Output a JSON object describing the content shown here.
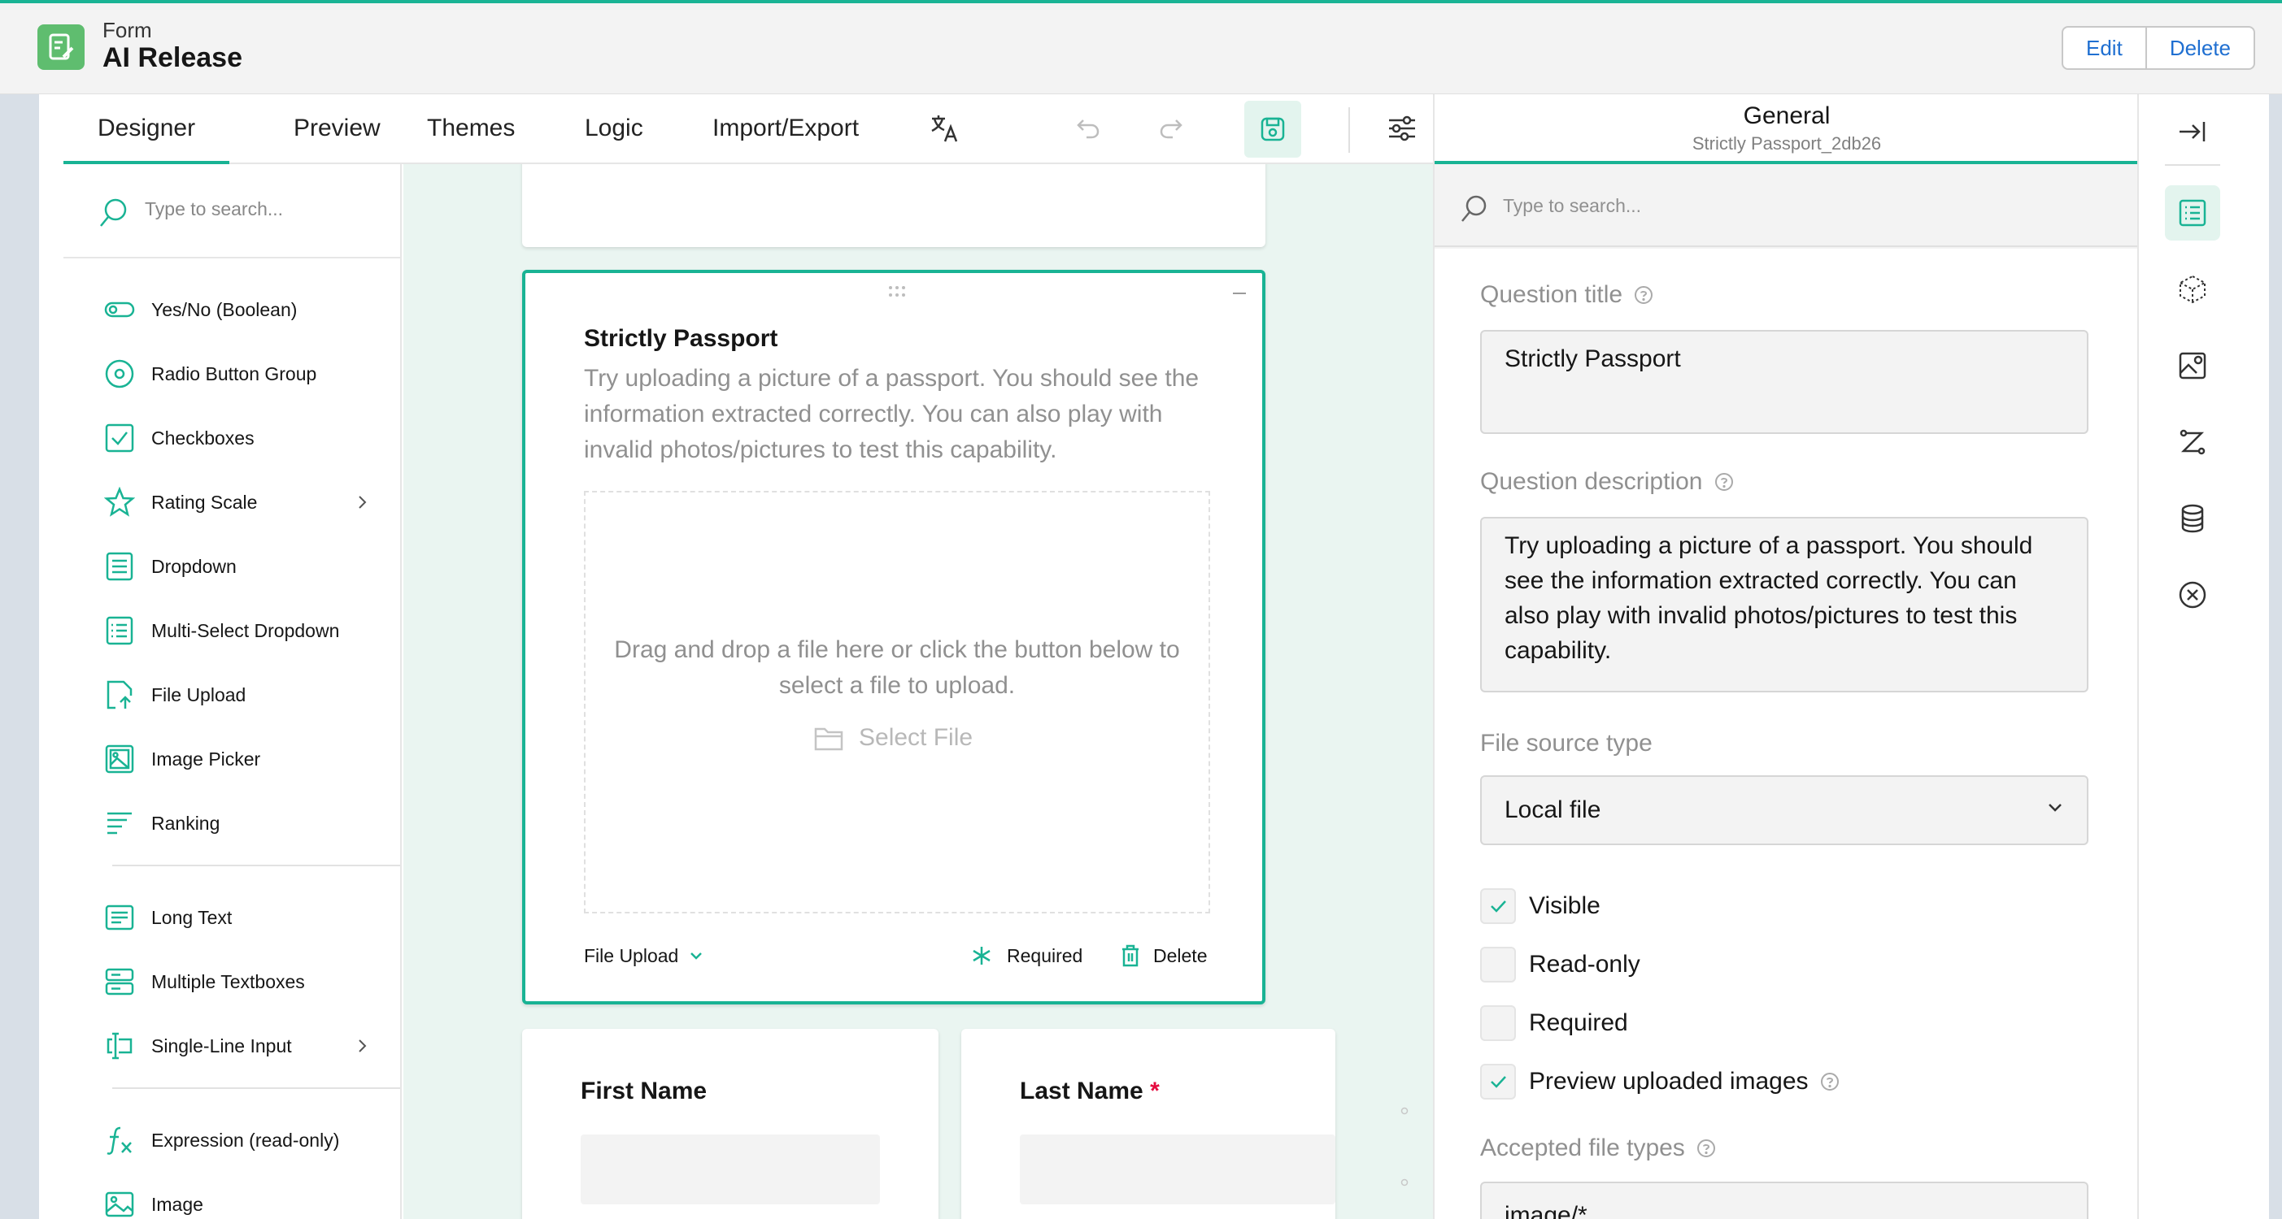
{
  "header": {
    "app_kind": "Form",
    "app_title": "AI Release",
    "edit_label": "Edit",
    "delete_label": "Delete"
  },
  "tabs": [
    {
      "label": "Designer",
      "active": true
    },
    {
      "label": "Preview"
    },
    {
      "label": "Themes"
    },
    {
      "label": "Logic"
    },
    {
      "label": "Import/Export"
    }
  ],
  "toolbox": {
    "search_placeholder": "Type to search...",
    "items": [
      {
        "label": "Yes/No (Boolean)",
        "icon": "toggle-icon"
      },
      {
        "label": "Radio Button Group",
        "icon": "radio-icon"
      },
      {
        "label": "Checkboxes",
        "icon": "checkbox-icon"
      },
      {
        "label": "Rating Scale",
        "icon": "star-icon",
        "has_submenu": true
      },
      {
        "label": "Dropdown",
        "icon": "dropdown-icon"
      },
      {
        "label": "Multi-Select Dropdown",
        "icon": "multi-dropdown-icon"
      },
      {
        "label": "File Upload",
        "icon": "file-upload-icon"
      },
      {
        "label": "Image Picker",
        "icon": "image-picker-icon"
      },
      {
        "label": "Ranking",
        "icon": "ranking-icon"
      },
      {
        "label": "Long Text",
        "icon": "long-text-icon"
      },
      {
        "label": "Multiple Textboxes",
        "icon": "multiple-textboxes-icon"
      },
      {
        "label": "Single-Line Input",
        "icon": "single-line-input-icon",
        "has_submenu": true
      },
      {
        "label": "Expression (read-only)",
        "icon": "expression-icon"
      },
      {
        "label": "Image",
        "icon": "image-icon"
      }
    ]
  },
  "question": {
    "title": "Strictly Passport",
    "description": "Try uploading a picture of a passport. You should see the information extracted correctly. You can also play with invalid photos/pictures to test this capability.",
    "dropzone_text": "Drag and drop a file here or click the button below to select a file to upload.",
    "select_file_label": "Select File",
    "type_label": "File Upload",
    "required_label": "Required",
    "delete_label": "Delete"
  },
  "next_questions": {
    "first_name": "First Name",
    "last_name": "Last Name",
    "required_mark": "*"
  },
  "properties": {
    "section_title": "General",
    "element_name": "Strictly Passport_2db26",
    "search_placeholder": "Type to search...",
    "question_title_label": "Question title",
    "question_title_value": "Strictly Passport",
    "question_description_label": "Question description",
    "question_description_value": "Try uploading a picture of a passport. You should see the information extracted correctly. You can also play with invalid photos/pictures to test this capability.",
    "file_source_label": "File source type",
    "file_source_value": "Local file",
    "checkboxes": [
      {
        "label": "Visible",
        "checked": true
      },
      {
        "label": "Read-only",
        "checked": false
      },
      {
        "label": "Required",
        "checked": false
      },
      {
        "label": "Preview uploaded images",
        "checked": true
      }
    ],
    "accepted_types_label": "Accepted file types",
    "accepted_types_value": "image/*"
  },
  "colors": {
    "accent": "#19b394",
    "required": "#e50a3e",
    "link": "#1f6fd1"
  }
}
